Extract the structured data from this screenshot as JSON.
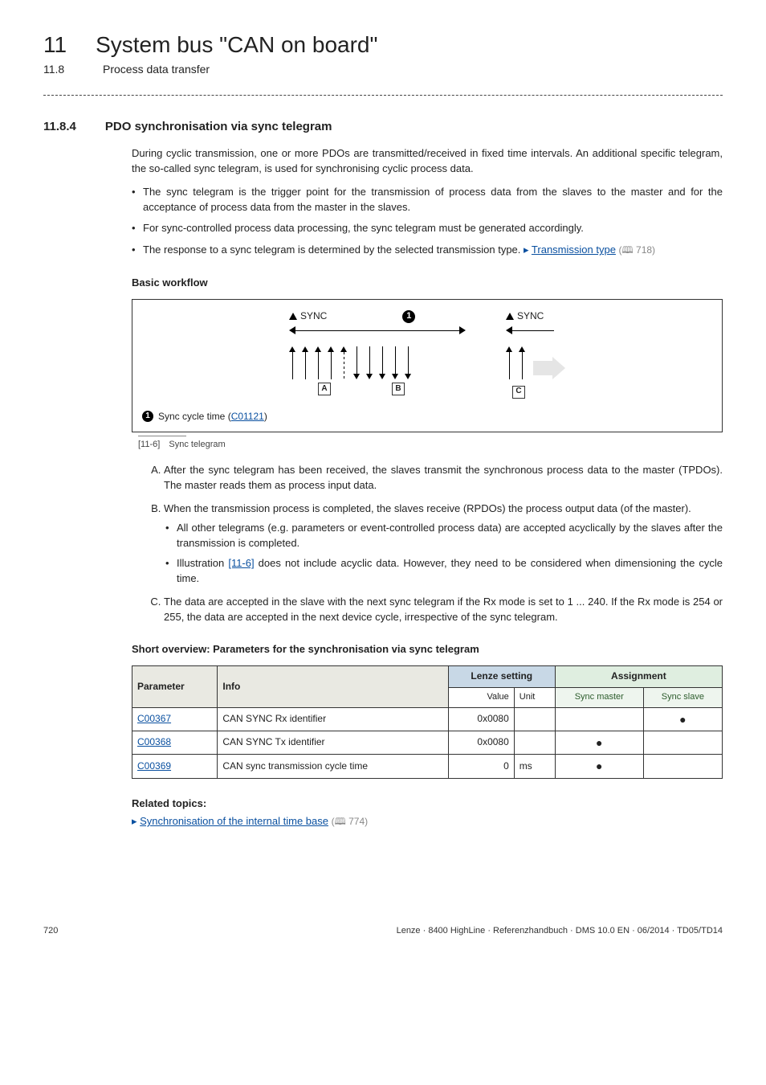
{
  "header": {
    "chapter_num": "11",
    "chapter_title": "System bus \"CAN on board\"",
    "section_num": "11.8",
    "section_title": "Process data transfer"
  },
  "section": {
    "num": "11.8.4",
    "title": "PDO synchronisation via sync telegram",
    "intro": "During cyclic transmission, one or more PDOs are transmitted/received in fixed time intervals. An additional specific telegram, the so-called sync telegram, is used for synchronising cyclic process data.",
    "bullets": {
      "b1": "The sync telegram is the trigger point for the transmission of process data from the slaves to the master and for the acceptance of process data from the master in the slaves.",
      "b2": "For sync-controlled process data processing, the sync telegram must be generated accordingly.",
      "b3_pre": "The response to a sync telegram is determined by the selected transmission type. ",
      "b3_link": "Transmission type",
      "b3_ref": " 718)"
    },
    "workflow_heading": "Basic workflow",
    "diagram": {
      "sync_label": "SYNC",
      "marker1": "1",
      "boxA": "A",
      "boxB": "B",
      "boxC": "C",
      "legend_num": "1",
      "legend_text_pre": "Sync cycle time (",
      "legend_link": "C01121",
      "legend_text_post": ")"
    },
    "figcap_num": "[11-6]",
    "figcap_text": "Sync telegram",
    "steps": {
      "A": "After the sync telegram has been received, the slaves transmit the synchronous process data to the master (TPDOs). The master reads them as process input data.",
      "B_main": "When the transmission process is completed, the slaves receive (RPDOs) the process output data (of the master).",
      "B_sub1": "All other telegrams (e.g. parameters or event-controlled process data) are accepted acyclically by the slaves after the transmission is completed.",
      "B_sub2_pre": "Illustration ",
      "B_sub2_link": "[11-6]",
      "B_sub2_post": " does not include acyclic data. However, they need to be considered when dimensioning the cycle time.",
      "C": "The data are accepted in the slave with the next sync telegram if the Rx mode is set to 1 ... 240. If the Rx mode is 254 or 255, the data are accepted in the next device cycle, irrespective of the sync telegram."
    },
    "paramtable_heading": "Short overview: Parameters for the synchronisation via sync telegram",
    "table": {
      "h_param": "Parameter",
      "h_info": "Info",
      "h_lenze": "Lenze setting",
      "h_assign": "Assignment",
      "sub_value": "Value",
      "sub_unit": "Unit",
      "sub_master": "Sync master",
      "sub_slave": "Sync slave",
      "rows": [
        {
          "param": "C00367",
          "info": "CAN SYNC Rx identifier",
          "value": "0x0080",
          "unit": "",
          "master": "",
          "slave": "●"
        },
        {
          "param": "C00368",
          "info": "CAN SYNC Tx identifier",
          "value": "0x0080",
          "unit": "",
          "master": "●",
          "slave": ""
        },
        {
          "param": "C00369",
          "info": "CAN sync transmission cycle time",
          "value": "0",
          "unit": "ms",
          "master": "●",
          "slave": ""
        }
      ]
    },
    "related_heading": "Related topics:",
    "related_link": "Synchronisation of the internal time base",
    "related_ref": " 774)"
  },
  "footer": {
    "page": "720",
    "right": "Lenze · 8400 HighLine · Referenzhandbuch · DMS 10.0 EN · 06/2014 · TD05/TD14"
  }
}
